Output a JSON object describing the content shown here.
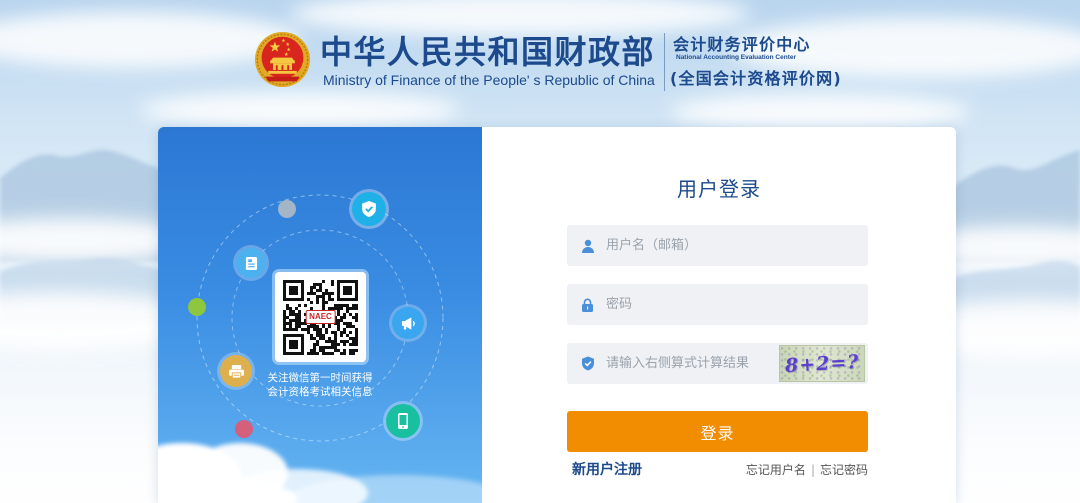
{
  "header": {
    "emblem_icon": "national-emblem-icon",
    "ministry_cn": "中华人民共和国财政部",
    "ministry_en": "Ministry of Finance of the People' s Republic of China",
    "center_cn": "会计财务评价中心",
    "center_en": "National Accounting Evaluation Center",
    "site_name": "(全国会计资格评价网)"
  },
  "promo": {
    "qr_logo_text": "NAEC",
    "caption": [
      "关注微信第一时间获得",
      "会计资格考试相关信息"
    ],
    "icons": [
      "shield-check-icon",
      "document-icon",
      "megaphone-icon",
      "printer-icon",
      "mobile-phone-icon"
    ]
  },
  "login": {
    "title": "用户登录",
    "username": {
      "icon": "user-icon",
      "value": "",
      "placeholder": "用户名（邮箱）"
    },
    "password": {
      "icon": "lock-icon",
      "value": "",
      "placeholder": "密码"
    },
    "captcha": {
      "icon": "shield-check-icon",
      "value": "",
      "placeholder": "请输入右侧算式计算结果",
      "image_text": "8+2=?"
    },
    "submit_label": "登录",
    "register_link": "新用户注册",
    "forgot_username_link": "忘记用户名",
    "separator": "|",
    "forgot_password_link": "忘记密码"
  },
  "colors": {
    "brand_blue": "#1c4a8d",
    "login_button": "#f28c00",
    "panel_blue_top": "#2b77d3",
    "panel_blue_bottom": "#66b6f2",
    "input_background": "#eff1f4",
    "input_icon": "#4a8fd9",
    "link_gray": "#555555",
    "orb_shield": "#20b0e8",
    "orb_document": "#4bb2ef",
    "orb_megaphone": "#3aa6ef",
    "orb_printer": "#ddb04d",
    "orb_phone": "#19c0a0",
    "dot_gray": "#a3b5c7",
    "dot_green": "#8dc63f",
    "dot_pink": "#d4607c"
  }
}
